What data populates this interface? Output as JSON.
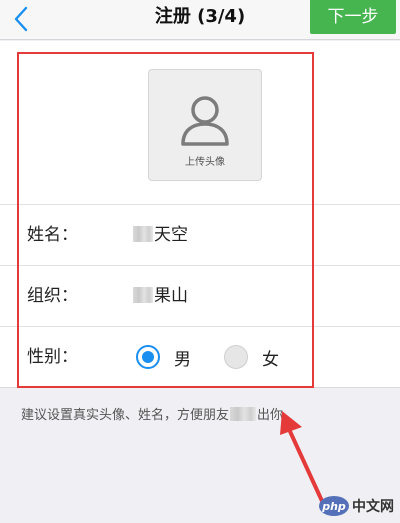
{
  "navbar": {
    "back_icon": "chevron-left-icon",
    "title": "注册 (3/4)",
    "next_label": "下一步",
    "accent_color": "#46b550"
  },
  "avatar": {
    "icon": "user-icon",
    "label": "上传头像"
  },
  "form": {
    "name": {
      "label": "姓名：",
      "value_visible": "天空"
    },
    "organization": {
      "label": "组织：",
      "value_visible": "果山"
    },
    "gender": {
      "label": "性别：",
      "options": [
        {
          "label": "男",
          "selected": true
        },
        {
          "label": "女",
          "selected": false
        }
      ]
    }
  },
  "hint": {
    "before": "建议设置真实头像、姓名，方便朋友",
    "after": "出你。"
  },
  "annotation": {
    "color": "#e53a3a"
  },
  "watermark": {
    "badge": "php",
    "text": "中文网"
  }
}
